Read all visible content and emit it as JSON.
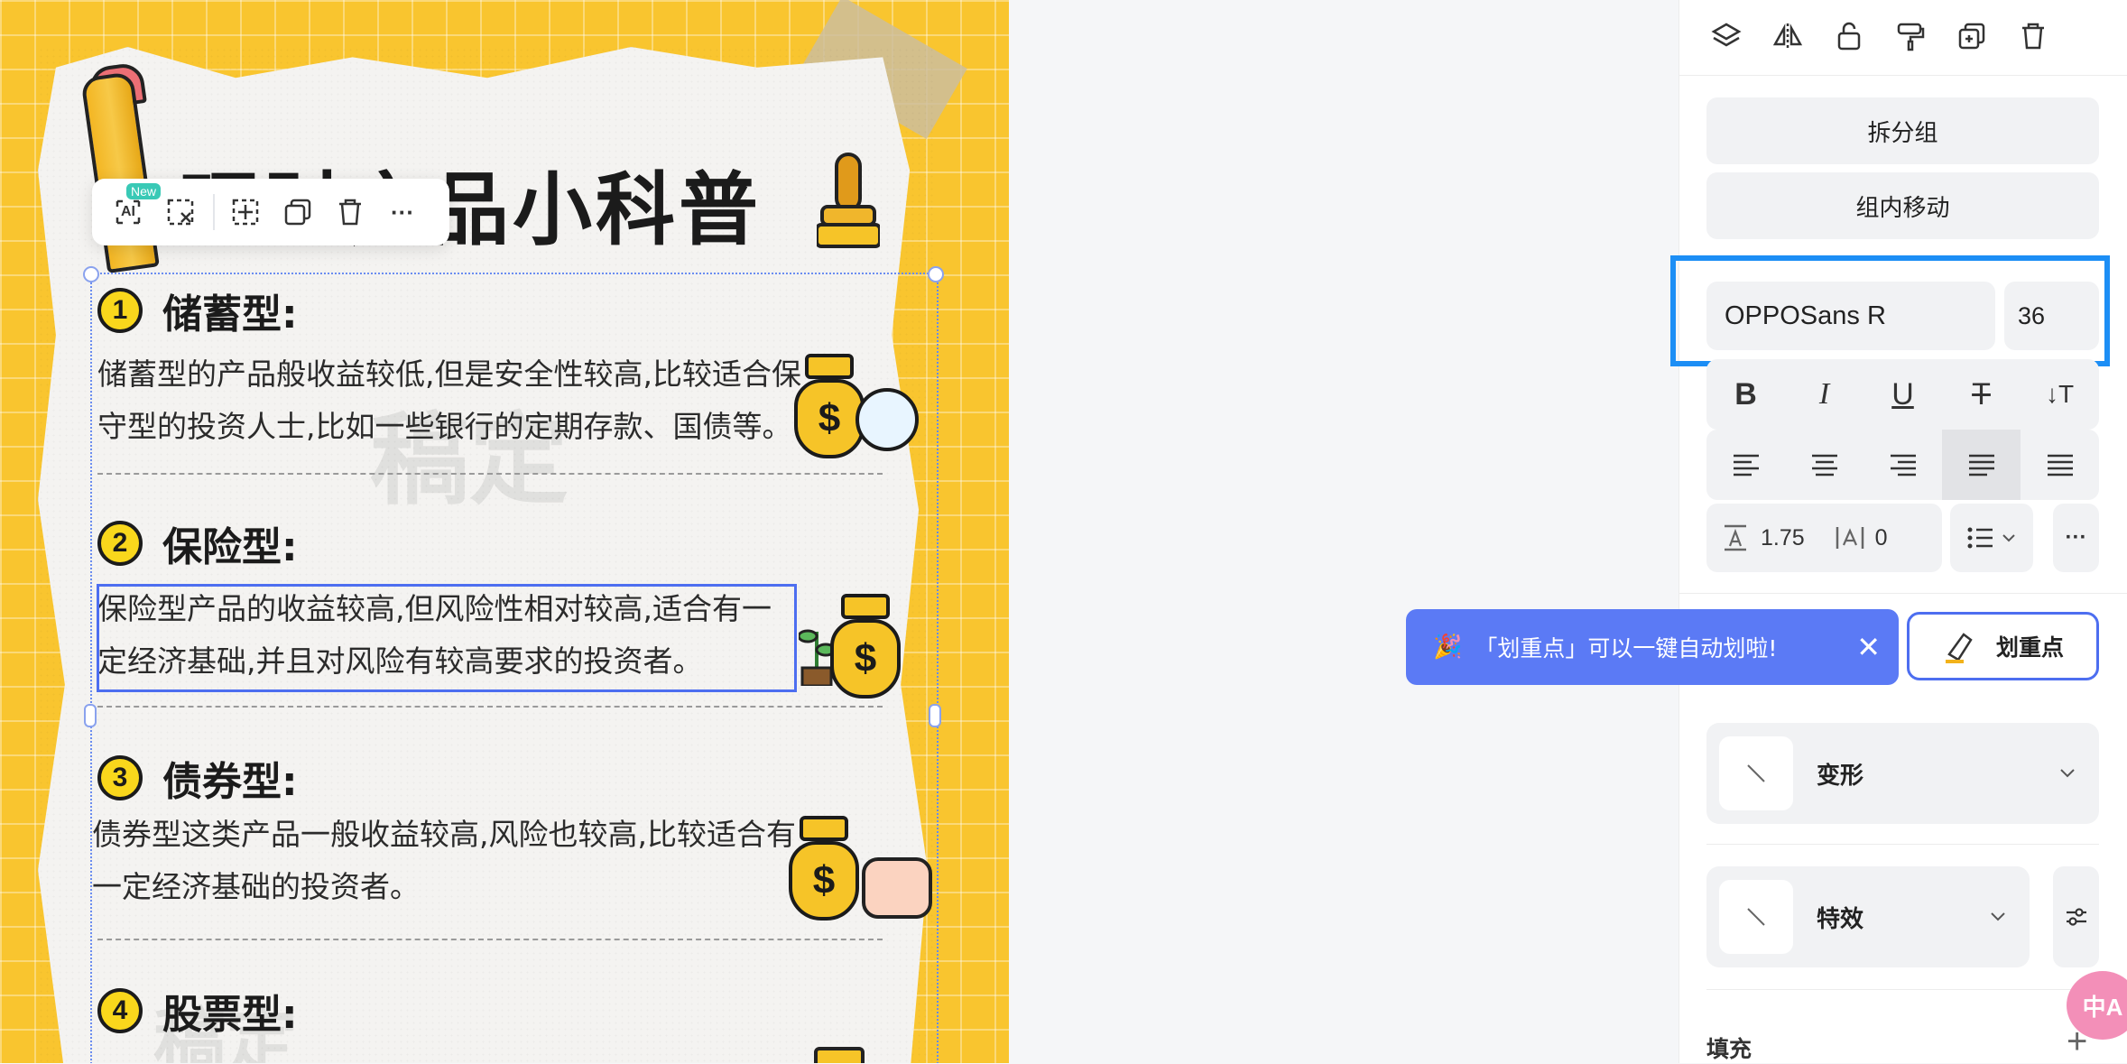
{
  "poster": {
    "title": "理财产品小科普",
    "watermark": "稿定",
    "sections": [
      {
        "num": "1",
        "heading": "储蓄型:",
        "text": "储蓄型的产品般收益较低,但是安全性较高,比较适合保守型的投资人士,比如一些银行的定期存款、国债等。"
      },
      {
        "num": "2",
        "heading": "保险型:",
        "text": "保险型产品的收益较高,但风险性相对较高,适合有一定经济基础,并且对风险有较高要求的投资者。"
      },
      {
        "num": "3",
        "heading": "债券型:",
        "text": "债券型这类产品一般收益较高,风险也较高,比较适合有一定经济基础的投资者。"
      },
      {
        "num": "4",
        "heading": "股票型:",
        "text": ""
      }
    ],
    "bag_symbol": "$"
  },
  "floating_toolbar": {
    "ai_label": "AI",
    "new_badge": "New",
    "more": "···"
  },
  "panel": {
    "ungroup": "拆分组",
    "move_in_group": "组内移动",
    "font_family": "OPPOSans R",
    "font_size": "36",
    "style_buttons": {
      "bold": "B",
      "italic": "I",
      "underline": "U",
      "strike": "T",
      "vertical": "↓T"
    },
    "line_height": "1.75",
    "letter_spacing": "0",
    "more": "···",
    "tip": "「划重点」可以一键自动划啦!",
    "tip_close": "✕",
    "highlight_btn": "划重点",
    "transform": "变形",
    "effects": "特效",
    "fill": "填充",
    "plus": "+",
    "translate_icon": "中A"
  },
  "colors": {
    "accent_blue": "#1c8ef5",
    "tip_blue": "#5b7af5",
    "poster_yellow": "#f9c52f"
  }
}
